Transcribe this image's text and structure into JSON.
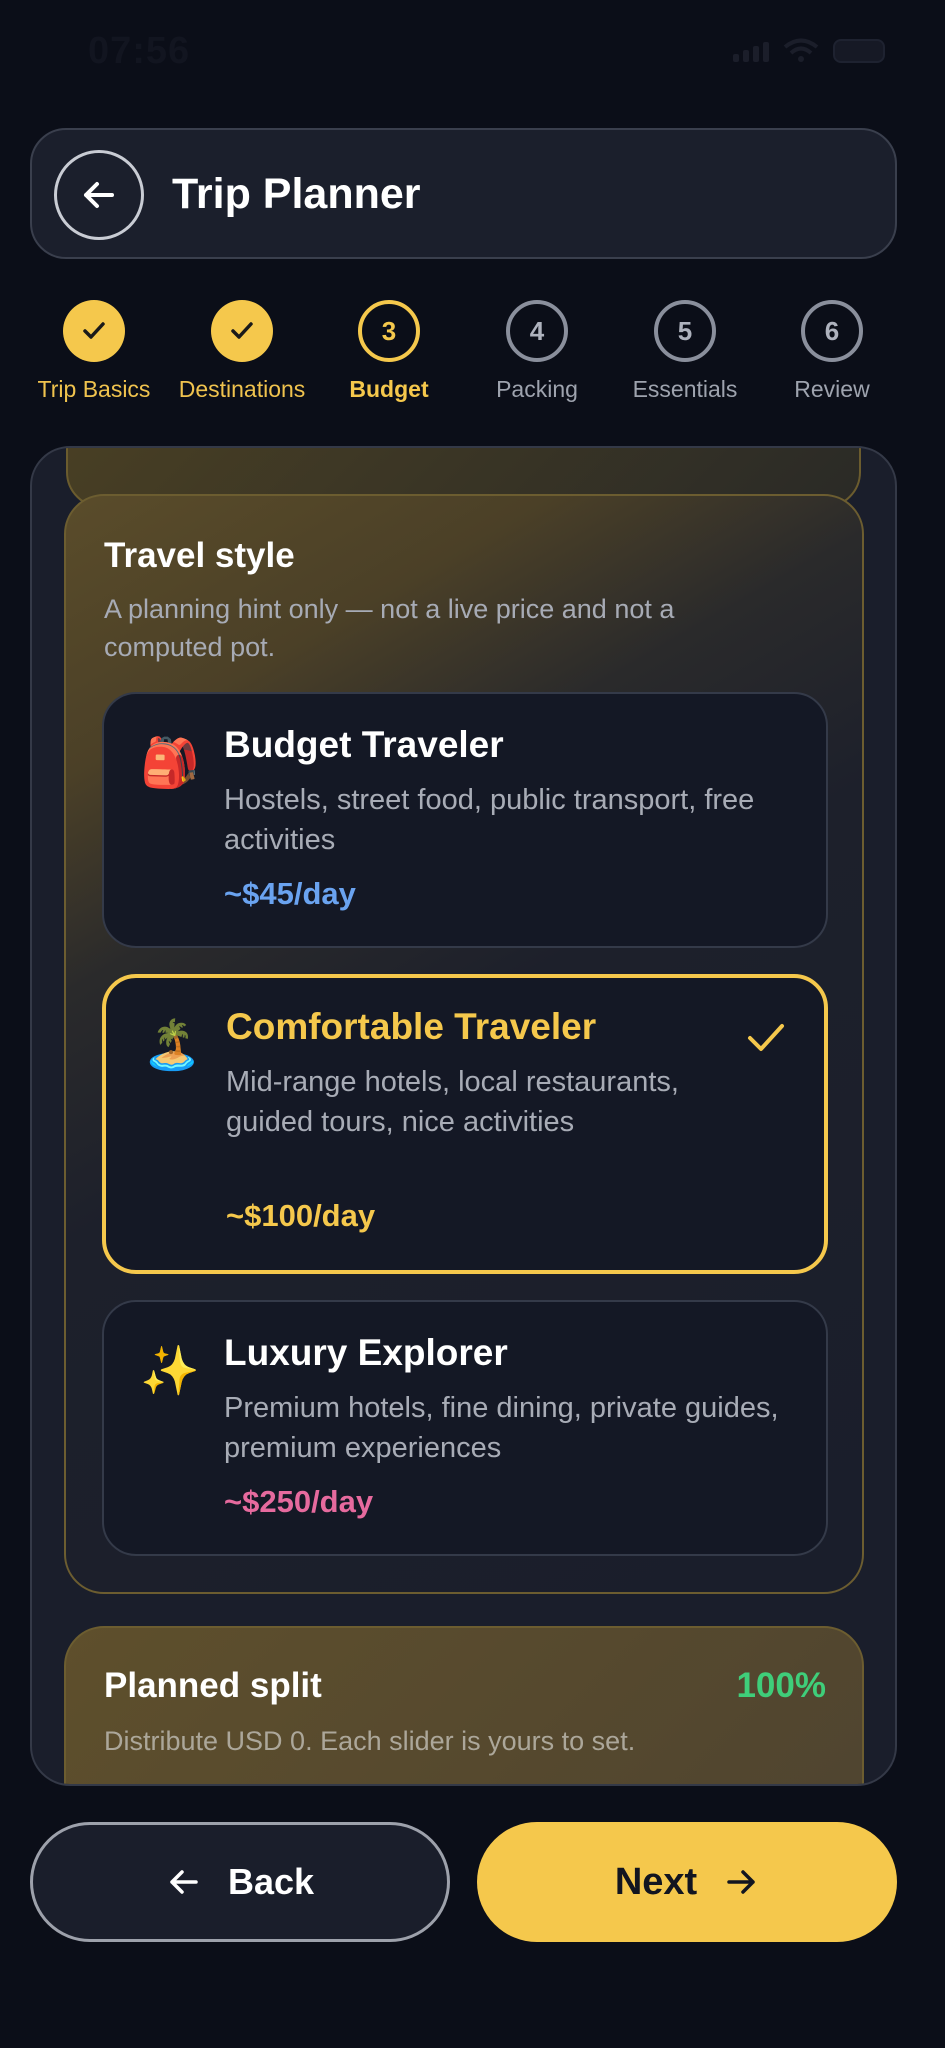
{
  "status_bar": {
    "time": "07:56"
  },
  "header": {
    "title": "Trip Planner"
  },
  "stepper": {
    "steps": [
      {
        "number": "1",
        "label": "Trip Basics",
        "state": "done"
      },
      {
        "number": "2",
        "label": "Destinations",
        "state": "done"
      },
      {
        "number": "3",
        "label": "Budget",
        "state": "active"
      },
      {
        "number": "4",
        "label": "Packing",
        "state": "todo"
      },
      {
        "number": "5",
        "label": "Essentials",
        "state": "todo"
      },
      {
        "number": "6",
        "label": "Review",
        "state": "todo"
      }
    ]
  },
  "travel_style": {
    "title": "Travel style",
    "subtitle": "A planning hint only — not a live price and not a computed pot.",
    "options": [
      {
        "icon": "🎒",
        "icon_name": "backpack-icon",
        "name": "Budget Traveler",
        "description": "Hostels, street food, public transport, free activities",
        "price": "~$45/day",
        "price_color": "#6aa3f0",
        "selected": false
      },
      {
        "icon": "🏝️",
        "icon_name": "island-icon",
        "name": "Comfortable Traveler",
        "description": "Mid-range hotels, local restaurants, guided tours, nice activities",
        "price": "~$100/day",
        "price_color": "#f5c84c",
        "selected": true
      },
      {
        "icon": "✨",
        "icon_name": "sparkles-icon",
        "name": "Luxury Explorer",
        "description": "Premium hotels, fine dining, private guides, premium experiences",
        "price": "~$250/day",
        "price_color": "#e66a9e",
        "selected": false
      }
    ]
  },
  "planned_split": {
    "title": "Planned split",
    "percent": "100%",
    "subtitle": "Distribute USD 0. Each slider is yours to set."
  },
  "footer": {
    "back_label": "Back",
    "next_label": "Next"
  },
  "colors": {
    "accent": "#f5c84c",
    "background": "#0b0e18",
    "success": "#3fce7a"
  }
}
